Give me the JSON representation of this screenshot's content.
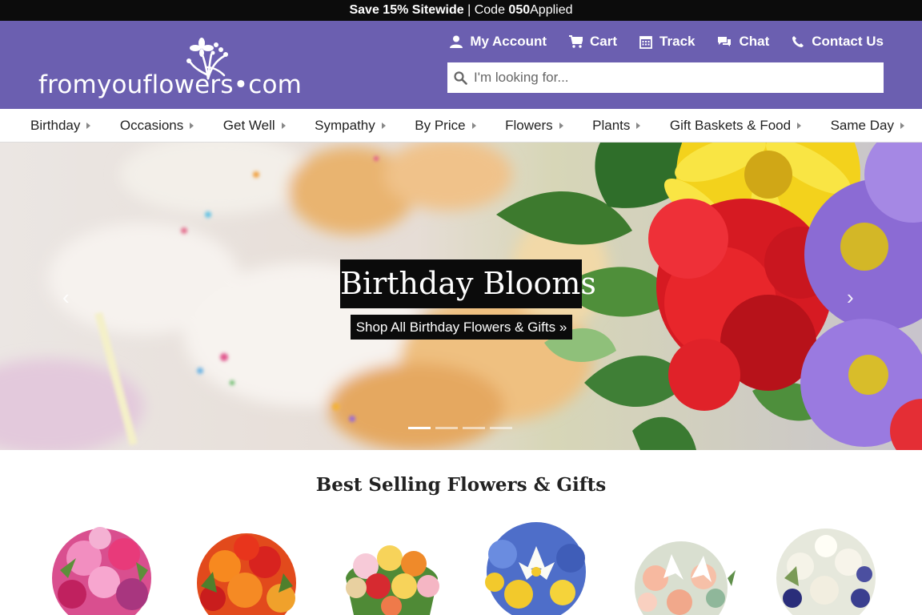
{
  "promo": {
    "strong": "Save 15% Sitewide",
    "divider": " | ",
    "code_label": "Code ",
    "code": "050",
    "applied": "Applied"
  },
  "brand": {
    "name": "fromyouflowers•com",
    "color": "#6b5fb0"
  },
  "toplinks": [
    {
      "label": "My Account",
      "icon": "person-icon"
    },
    {
      "label": "Cart",
      "icon": "cart-icon"
    },
    {
      "label": "Track",
      "icon": "calendar-icon"
    },
    {
      "label": "Chat",
      "icon": "chat-icon"
    },
    {
      "label": "Contact Us",
      "icon": "phone-icon"
    }
  ],
  "search": {
    "placeholder": "I'm looking for..."
  },
  "nav": [
    "Birthday",
    "Occasions",
    "Get Well",
    "Sympathy",
    "By Price",
    "Flowers",
    "Plants",
    "Gift Baskets & Food",
    "Same Day"
  ],
  "hero": {
    "title": "Birthday Blooms",
    "cta": "Shop All Birthday Flowers & Gifts »",
    "slides": 4,
    "active_slide": 1
  },
  "best_sellers": {
    "title": "Best Selling Flowers & Gifts",
    "products": [
      {
        "name": "pink-lily-rose-bouquet"
      },
      {
        "name": "orange-red-rose-bouquet"
      },
      {
        "name": "rainbow-rose-bouquet"
      },
      {
        "name": "blue-yellow-lily-bouquet"
      },
      {
        "name": "peach-white-lily-bouquet"
      },
      {
        "name": "white-purple-rose-bouquet"
      }
    ]
  }
}
